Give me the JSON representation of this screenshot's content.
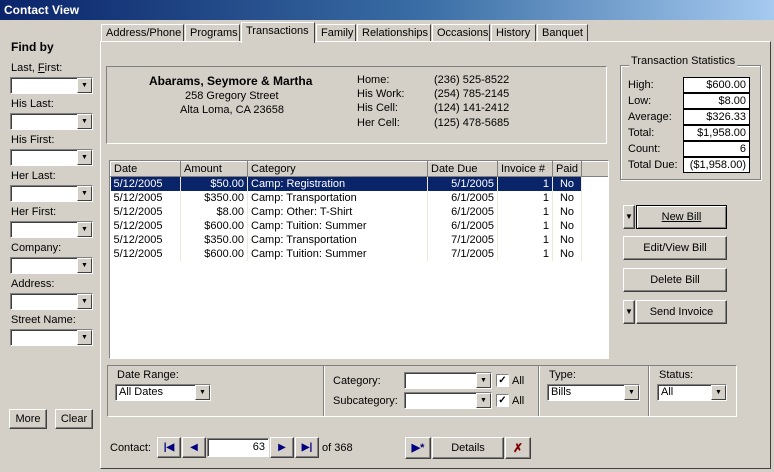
{
  "window": {
    "title": "Contact View"
  },
  "sidebar": {
    "heading": "Find by",
    "fields": [
      {
        "label": "Last, First:",
        "underline": "F",
        "value": ""
      },
      {
        "label": "His Last:",
        "value": ""
      },
      {
        "label": "His First:",
        "value": ""
      },
      {
        "label": "Her Last:",
        "value": ""
      },
      {
        "label": "Her First:",
        "value": ""
      },
      {
        "label": "Company:",
        "value": ""
      },
      {
        "label": "Address:",
        "value": ""
      },
      {
        "label": "Street Name:",
        "value": ""
      }
    ],
    "more_label": "More",
    "clear_label": "Clear"
  },
  "tabs": [
    {
      "label": "Address/Phone"
    },
    {
      "label": "Programs"
    },
    {
      "label": "Transactions",
      "active": true
    },
    {
      "label": "Family"
    },
    {
      "label": "Relationships"
    },
    {
      "label": "Occasions"
    },
    {
      "label": "History"
    },
    {
      "label": "Banquet"
    }
  ],
  "contact": {
    "name": "Abarams, Seymore & Martha",
    "street": "258 Gregory Street",
    "city": "Alta Loma, CA 23658",
    "phones": [
      {
        "label": "Home:",
        "value": "(236) 525-8522"
      },
      {
        "label": "His Work:",
        "value": "(254) 785-2145"
      },
      {
        "label": "His Cell:",
        "value": "(124) 141-2412"
      },
      {
        "label": "Her Cell:",
        "value": "(125) 478-5685"
      }
    ]
  },
  "stats": {
    "title": "Transaction Statistics",
    "rows": [
      {
        "label": "High:",
        "value": "$600.00"
      },
      {
        "label": "Low:",
        "value": "$8.00"
      },
      {
        "label": "Average:",
        "value": "$326.33"
      },
      {
        "label": "Total:",
        "value": "$1,958.00"
      },
      {
        "label": "Count:",
        "value": "6"
      },
      {
        "label": "Total Due:",
        "value": "($1,958.00)"
      }
    ]
  },
  "table": {
    "columns": [
      "Date",
      "Amount",
      "Category",
      "Date Due",
      "Invoice #",
      "Paid"
    ],
    "rows": [
      [
        "5/12/2005",
        "$50.00",
        "Camp: Registration",
        "5/1/2005",
        "1",
        "No"
      ],
      [
        "5/12/2005",
        "$350.00",
        "Camp: Transportation",
        "6/1/2005",
        "1",
        "No"
      ],
      [
        "5/12/2005",
        "$8.00",
        "Camp: Other: T-Shirt",
        "6/1/2005",
        "1",
        "No"
      ],
      [
        "5/12/2005",
        "$600.00",
        "Camp: Tuition: Summer",
        "6/1/2005",
        "1",
        "No"
      ],
      [
        "5/12/2005",
        "$350.00",
        "Camp: Transportation",
        "7/1/2005",
        "1",
        "No"
      ],
      [
        "5/12/2005",
        "$600.00",
        "Camp: Tuition: Summer",
        "7/1/2005",
        "1",
        "No"
      ]
    ],
    "selected_row": 0
  },
  "actions": {
    "new_bill": "New Bill",
    "edit_bill": "Edit/View Bill",
    "delete_bill": "Delete Bill",
    "send_invoice": "Send Invoice"
  },
  "filters": {
    "date_range_label": "Date Range:",
    "date_range_value": "All Dates",
    "category_label": "Category:",
    "category_value": "",
    "subcategory_label": "Subcategory:",
    "subcategory_value": "",
    "all_label": "All",
    "type_label": "Type:",
    "type_value": "Bills",
    "status_label": "Status:",
    "status_value": "All"
  },
  "nav": {
    "contact_label": "Contact:",
    "record": "63",
    "of_label": "of 368",
    "details_label": "Details"
  }
}
